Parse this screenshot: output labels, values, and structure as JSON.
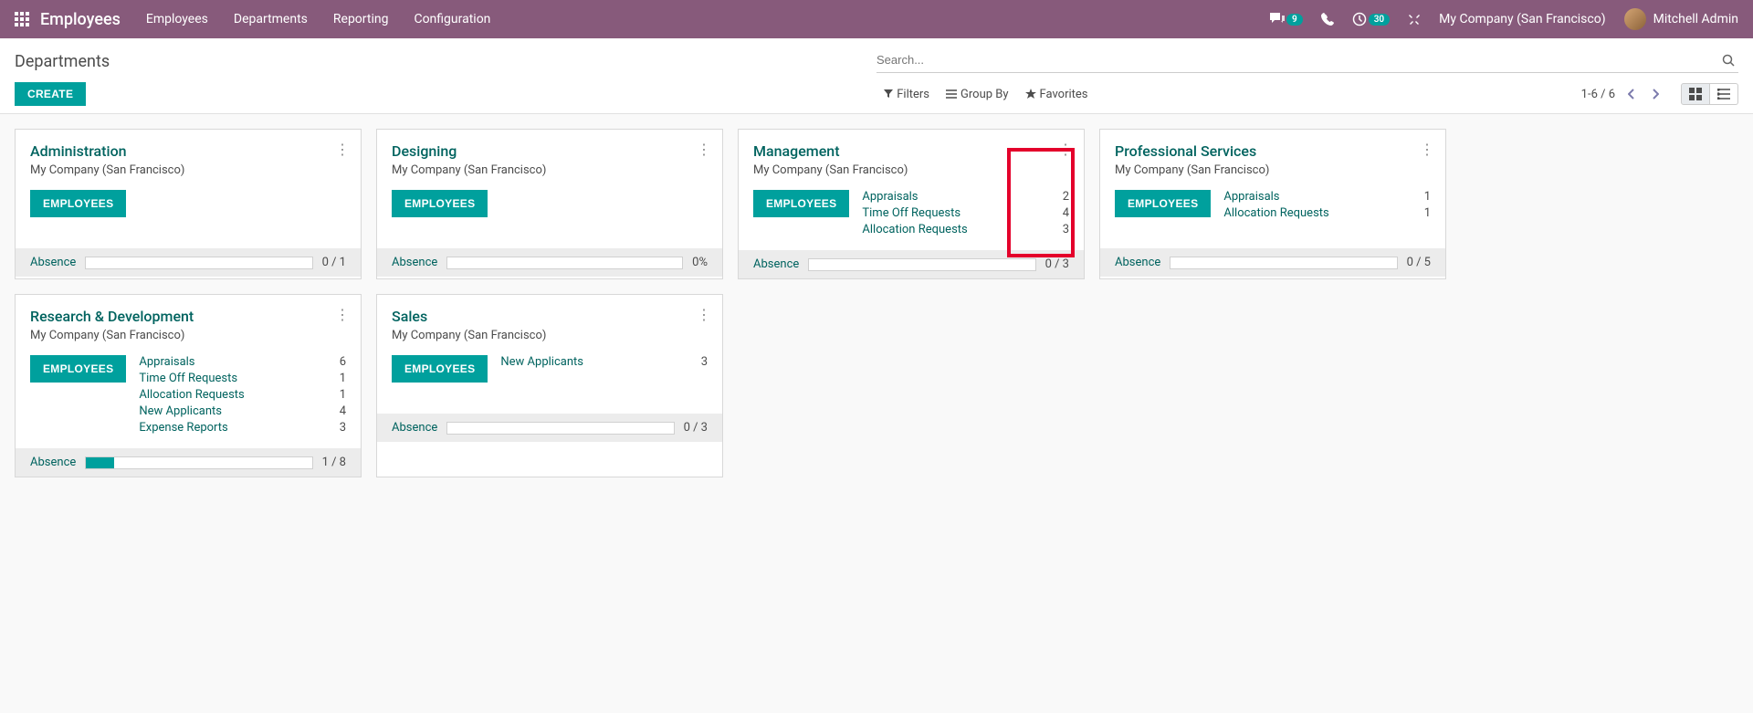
{
  "header": {
    "app_title": "Employees",
    "nav": [
      "Employees",
      "Departments",
      "Reporting",
      "Configuration"
    ],
    "msg_badge": "9",
    "clock_badge": "30",
    "company": "My Company (San Francisco)",
    "user": "Mitchell Admin"
  },
  "subheader": {
    "breadcrumb": "Departments",
    "search_placeholder": "Search...",
    "create": "CREATE",
    "filters": "Filters",
    "group_by": "Group By",
    "favorites": "Favorites",
    "pager": "1-6 / 6"
  },
  "absence_label": "Absence",
  "employees_btn": "EMPLOYEES",
  "cards": [
    {
      "title": "Administration",
      "company": "My Company (San Francisco)",
      "stats": [],
      "absence": "0 / 1",
      "fill": 0
    },
    {
      "title": "Designing",
      "company": "My Company (San Francisco)",
      "stats": [],
      "absence": "0%",
      "fill": 0
    },
    {
      "title": "Management",
      "company": "My Company (San Francisco)",
      "stats": [
        {
          "label": "Appraisals",
          "val": "2"
        },
        {
          "label": "Time Off Requests",
          "val": "4"
        },
        {
          "label": "Allocation Requests",
          "val": "3"
        }
      ],
      "absence": "0 / 3",
      "fill": 0,
      "highlight": true
    },
    {
      "title": "Professional Services",
      "company": "My Company (San Francisco)",
      "stats": [
        {
          "label": "Appraisals",
          "val": "1"
        },
        {
          "label": "Allocation Requests",
          "val": "1"
        }
      ],
      "absence": "0 / 5",
      "fill": 0
    },
    {
      "title": "Research & Development",
      "company": "My Company (San Francisco)",
      "stats": [
        {
          "label": "Appraisals",
          "val": "6"
        },
        {
          "label": "Time Off Requests",
          "val": "1"
        },
        {
          "label": "Allocation Requests",
          "val": "1"
        },
        {
          "label": "New Applicants",
          "val": "4"
        },
        {
          "label": "Expense Reports",
          "val": "3"
        }
      ],
      "absence": "1 / 8",
      "fill": 12.5
    },
    {
      "title": "Sales",
      "company": "My Company (San Francisco)",
      "stats": [
        {
          "label": "New Applicants",
          "val": "3"
        }
      ],
      "absence": "0 / 3",
      "fill": 0
    }
  ]
}
